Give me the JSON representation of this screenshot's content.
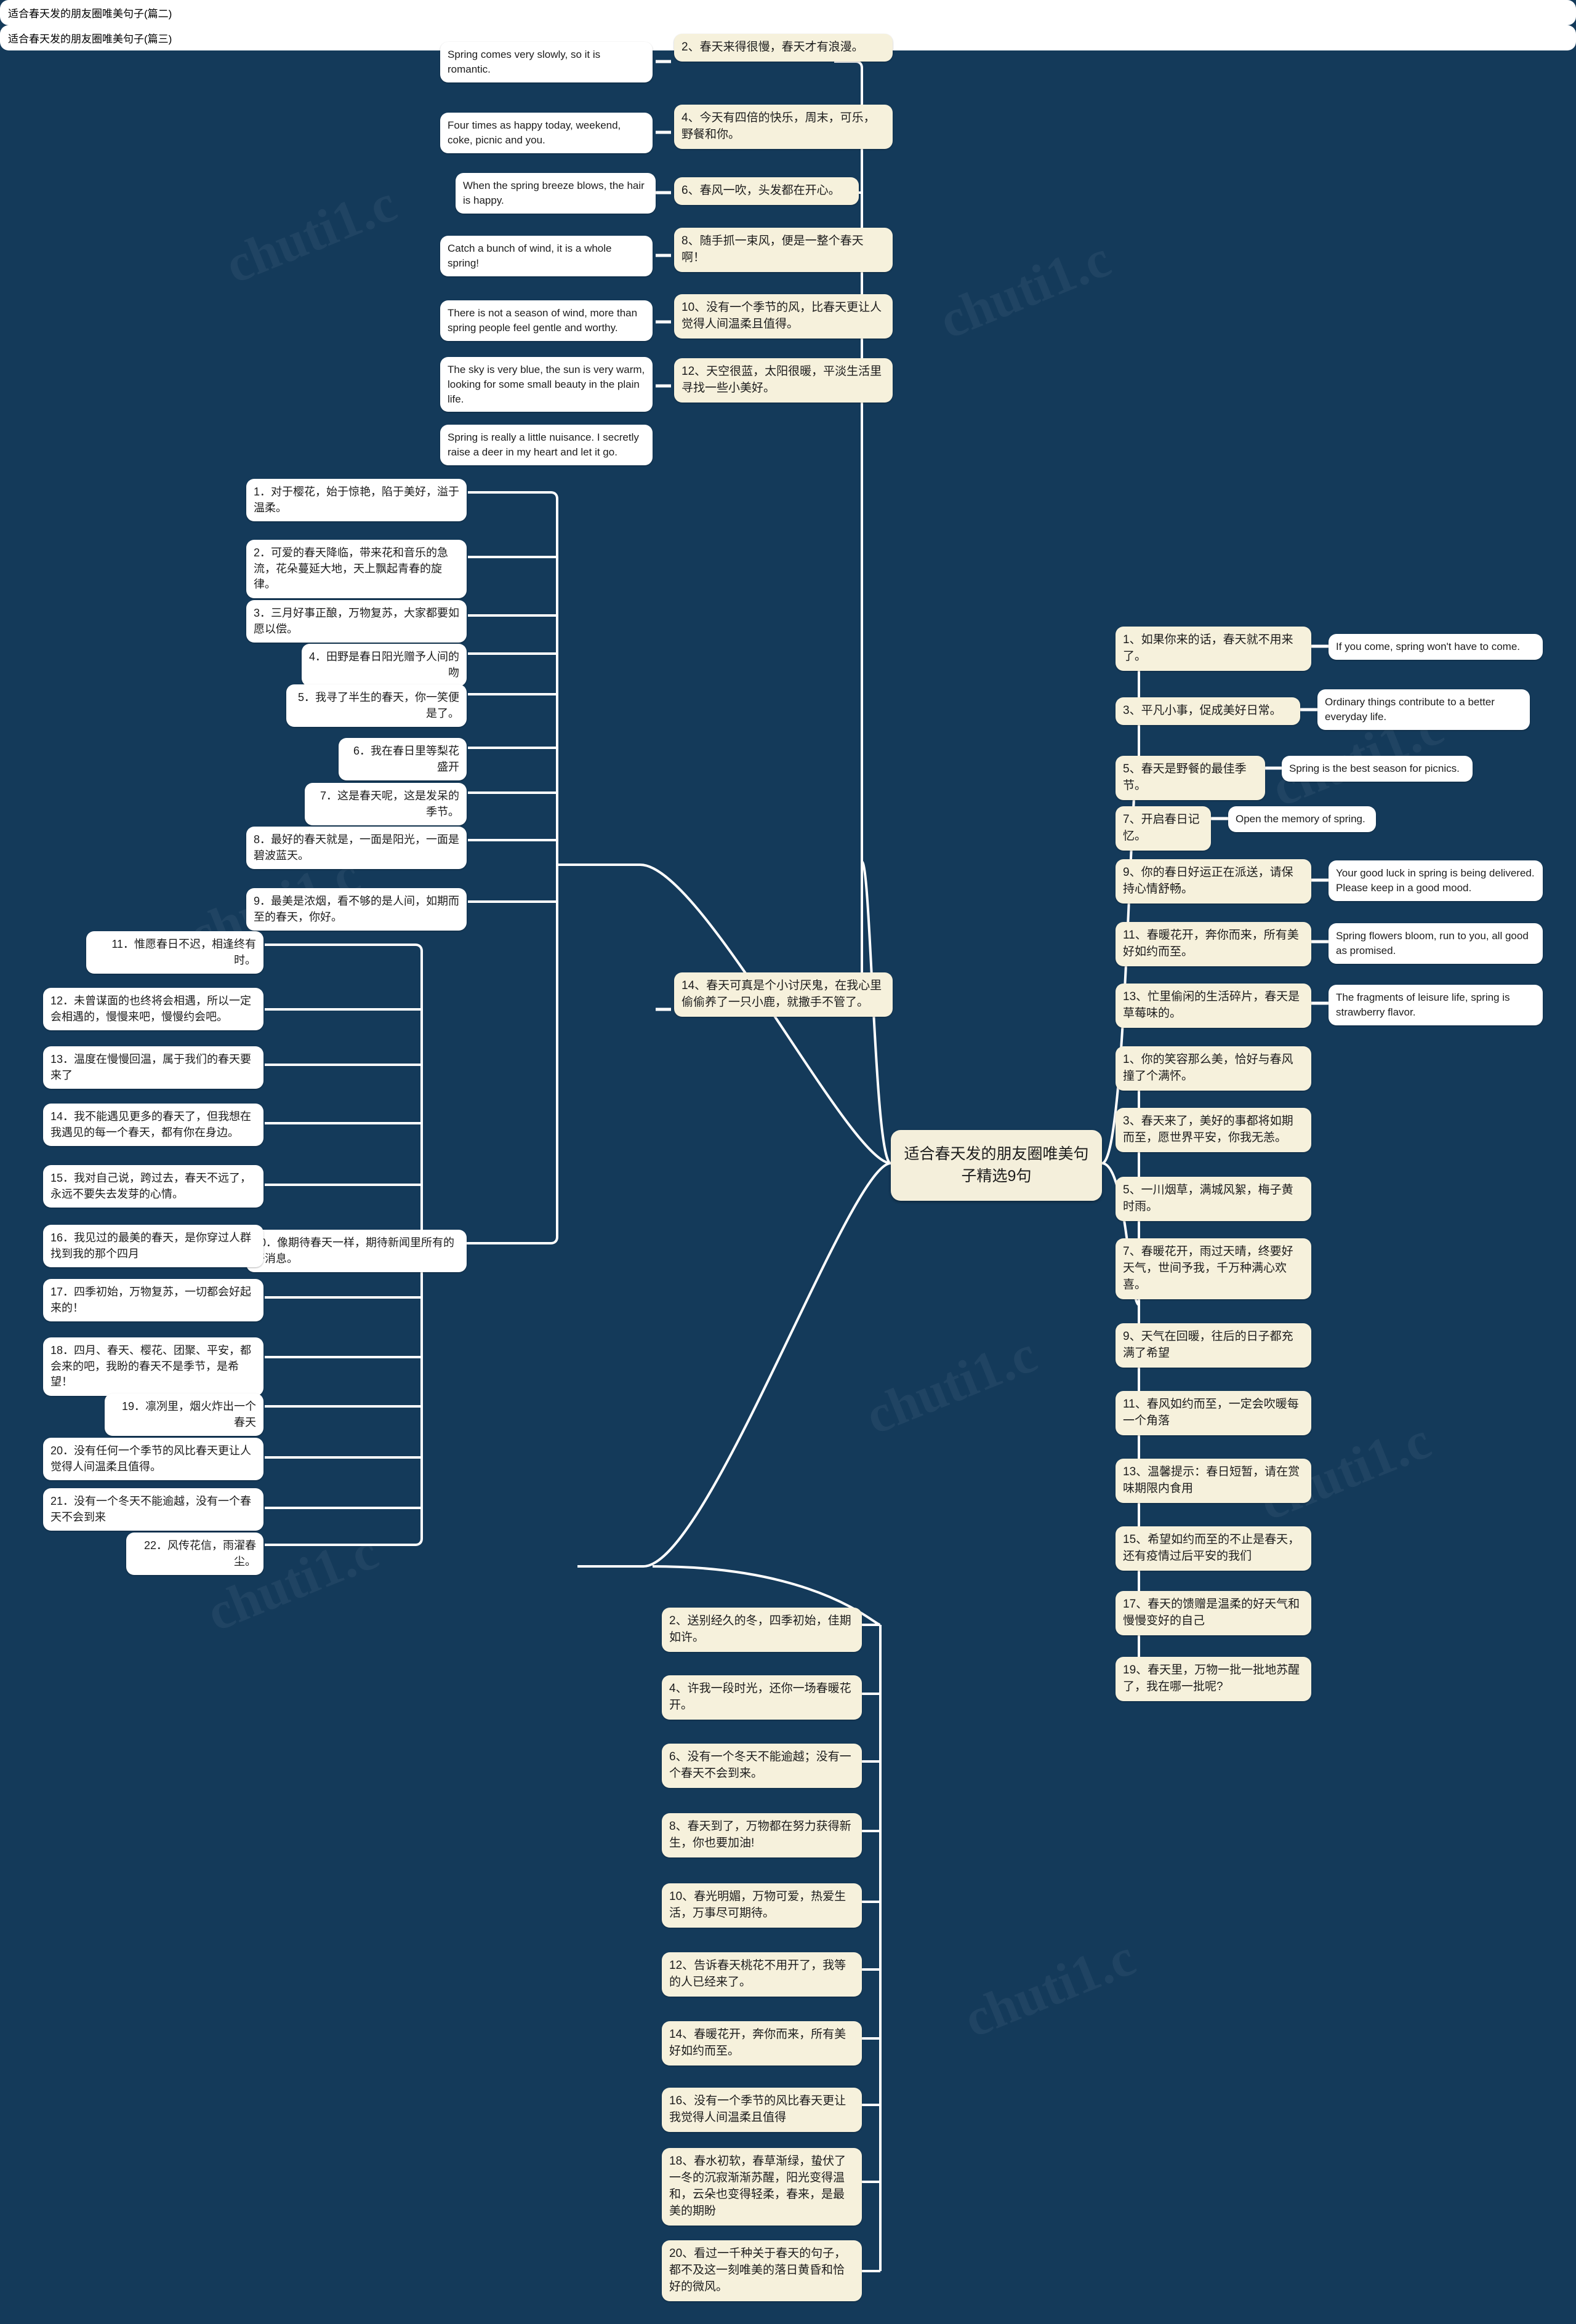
{
  "meta": {
    "title": "适合春天发的朋友圈唯美句子精选9句",
    "background_color": "#143a5a",
    "node_color_white": "#ffffff",
    "node_color_cream": "#f6f1dc",
    "text_color": "#1c1c1c",
    "watermark": "chuti1.c"
  },
  "root": {
    "label": "适合春天发的朋友圈唯美句子精选9句"
  },
  "branches": {
    "pian_er": "适合春天发的朋友圈唯美句子(篇二)",
    "pian_san": "适合春天发的朋友圈唯美句子(篇三)"
  },
  "top_branch": {
    "pairs": [
      {
        "en": "Spring comes very slowly, so it is romantic.",
        "cn": "2、春天来得很慢，春天才有浪漫。"
      },
      {
        "en": "Four times as happy today, weekend, coke, picnic and you.",
        "cn": "4、今天有四倍的快乐，周末，可乐，野餐和你。"
      },
      {
        "en": "When the spring breeze blows, the hair is happy.",
        "cn": "6、春风一吹，头发都在开心。"
      },
      {
        "en": "Catch a bunch of wind, it is a whole spring!",
        "cn": "8、随手抓一束风，便是一整个春天啊！"
      },
      {
        "en": "There is not a season of wind, more than spring people feel gentle and worthy.",
        "cn": "10、没有一个季节的风，比春天更让人觉得人间温柔且值得。"
      },
      {
        "en": "The sky is very blue, the sun is very warm, looking for some small beauty in the plain life.",
        "cn": "12、天空很蓝，太阳很暖，平淡生活里寻找一些小美好。"
      },
      {
        "en": "Spring is really a little nuisance. I secretly raise a deer in my heart and let it go.",
        "cn": "14、春天可真是个小讨厌鬼，在我心里偷偷养了一只小鹿，就撒手不管了。"
      }
    ]
  },
  "pian_er_items": [
    "1．对于樱花，始于惊艳，陷于美好，溢于温柔。",
    "2．可爱的春天降临，带来花和音乐的急流，花朵蔓延大地，天上飘起青春的旋律。",
    "3．三月好事正酿，万物复苏，大家都要如愿以偿。",
    "4．田野是春日阳光赠予人间的吻",
    "5．我寻了半生的春天，你一笑便是了。",
    "6．我在春日里等梨花盛开",
    "7．这是春天呢，这是发呆的季节。",
    "8．最好的春天就是，一面是阳光，一面是碧波蓝天。",
    "9．最美是浓烟，看不够的是人间，如期而至的春天，你好。",
    "10．像期待春天一样，期待新闻里所有的好消息。",
    "11．惟愿春日不迟，相逢终有时。",
    "12．未曾谋面的也终将会相遇，所以一定会相遇的，慢慢来吧，慢慢约会吧。",
    "13．温度在慢慢回温，属于我们的春天要来了",
    "14．我不能遇见更多的春天了，但我想在我遇见的每一个春天，都有你在身边。",
    "15．我对自己说，跨过去，春天不远了，永远不要失去发芽的心情。",
    "16．我见过的最美的春天，是你穿过人群找到我的那个四月",
    "17．四季初始，万物复苏，一切都会好起来的！",
    "18．四月、春天、樱花、团聚、平安，都会来的吧，我盼的春天不是季节，是希望！",
    "19．凛冽里，烟火炸出一个春天",
    "20．没有任何一个季节的风比春天更让人觉得人间温柔且值得。",
    "21．没有一个冬天不能逾越，没有一个春天不会到来",
    "22．风传花信，雨濯春尘。"
  ],
  "right_branch_pairs": [
    {
      "cn": "1、如果你来的话，春天就不用来了。",
      "en": "If you come, spring won't have to come."
    },
    {
      "cn": "3、平凡小事，促成美好日常。",
      "en": "Ordinary things contribute to a better everyday life."
    },
    {
      "cn": "5、春天是野餐的最佳季节。",
      "en": "Spring is the best season for picnics."
    },
    {
      "cn": "7、开启春日记忆。",
      "en": "Open the memory of spring."
    },
    {
      "cn": "9、你的春日好运正在派送，请保持心情舒畅。",
      "en": "Your good luck in spring is being delivered. Please keep in a good mood."
    },
    {
      "cn": "11、春暖花开，奔你而来，所有美好如约而至。",
      "en": "Spring flowers bloom, run to you, all good as promised."
    },
    {
      "cn": "13、忙里偷闲的生活碎片，春天是草莓味的。",
      "en": "The fragments of leisure life, spring is strawberry flavor."
    }
  ],
  "right_lower_items": [
    "1、你的笑容那么美，恰好与春风撞了个满怀。",
    "3、春天来了，美好的事都将如期而至，愿世界平安，你我无恙。",
    "5、一川烟草，满城风絮，梅子黄时雨。",
    "7、春暖花开，雨过天晴，终要好天气，世间予我，千万种满心欢喜。",
    "9、天气在回暖，往后的日子都充满了希望",
    "11、春风如约而至，一定会吹暖每一个角落",
    "13、温馨提示：春日短暂，请在赏味期限内食用",
    "15、希望如约而至的不止是春天，还有疫情过后平安的我们",
    "17、春天的馈赠是温柔的好天气和慢慢变好的自己",
    "19、春天里，万物一批一批地苏醒了，我在哪一批呢?"
  ],
  "bottom_center_items": [
    "2、送别经久的冬，四季初始，佳期如许。",
    "4、许我一段时光，还你一场春暖花开。",
    "6、没有一个冬天不能逾越；没有一个春天不会到来。",
    "8、春天到了，万物都在努力获得新生，你也要加油!",
    "10、春光明媚，万物可爱，热爱生活，万事尽可期待。",
    "12、告诉春天桃花不用开了，我等的人已经来了。",
    "14、春暖花开，奔你而来，所有美好如约而至。",
    "16、没有一个季节的风比春天更让我觉得人间温柔且值得",
    "18、春水初软，春草渐绿，蛰伏了一冬的沉寂渐渐苏醒，阳光变得温和，云朵也变得轻柔，春来，是最美的期盼",
    "20、看过一千种关于春天的句子，都不及这一刻唯美的落日黄昏和恰好的微风。"
  ]
}
